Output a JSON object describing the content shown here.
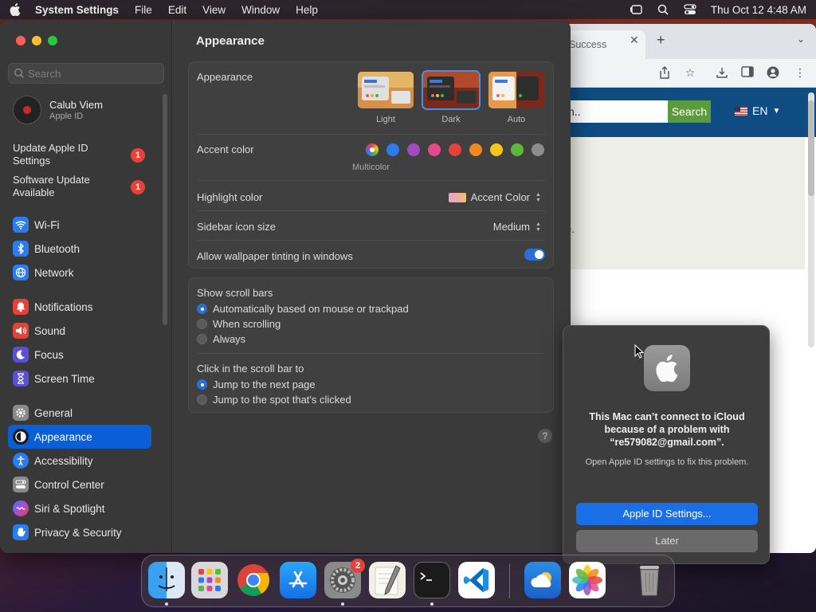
{
  "menubar": {
    "app_name": "System Settings",
    "menus": [
      "File",
      "Edit",
      "View",
      "Window",
      "Help"
    ],
    "datetime": "Thu Oct 12  4:48 AM"
  },
  "browser": {
    "tab_title": "Success",
    "search_text": "ch..",
    "search_button": "Search",
    "language": "EN",
    "fragment": "e."
  },
  "sidebar": {
    "search_placeholder": "Search",
    "account_name": "Calub Viem",
    "account_sub": "Apple ID",
    "notices": [
      {
        "label": "Update Apple ID Settings",
        "badge": "1"
      },
      {
        "label": "Software Update Available",
        "badge": "1"
      }
    ],
    "items": [
      {
        "label": "Wi-Fi",
        "icon": "wifi-icon",
        "color": "#2a7cf0"
      },
      {
        "label": "Bluetooth",
        "icon": "bluetooth-icon",
        "color": "#2a7cf0"
      },
      {
        "label": "Network",
        "icon": "globe-icon",
        "color": "#2a7cf0"
      },
      {
        "label": "Notifications",
        "icon": "bell-icon",
        "color": "#e8413a"
      },
      {
        "label": "Sound",
        "icon": "speaker-icon",
        "color": "#e8413a"
      },
      {
        "label": "Focus",
        "icon": "moon-icon",
        "color": "#5b4fd6"
      },
      {
        "label": "Screen Time",
        "icon": "hourglass-icon",
        "color": "#5b4fd6"
      },
      {
        "label": "General",
        "icon": "gear-icon",
        "color": "#8a8a8a"
      },
      {
        "label": "Appearance",
        "icon": "appearance-icon",
        "color": "#1c1c1c"
      },
      {
        "label": "Accessibility",
        "icon": "accessibility-icon",
        "color": "#2a7cf0"
      },
      {
        "label": "Control Center",
        "icon": "control-center-icon",
        "color": "#8a8a8a"
      },
      {
        "label": "Siri & Spotlight",
        "icon": "siri-icon",
        "color": "#b04ad6"
      },
      {
        "label": "Privacy & Security",
        "icon": "hand-icon",
        "color": "#2a7cf0"
      }
    ],
    "selected": "Appearance"
  },
  "main": {
    "title": "Appearance",
    "appearance_label": "Appearance",
    "appearance_options": [
      "Light",
      "Dark",
      "Auto"
    ],
    "appearance_selected": "Dark",
    "accent_label": "Accent color",
    "accent_colors": [
      "#2a7cf0",
      "#a24ac2",
      "#e8488a",
      "#e8413a",
      "#f08a20",
      "#f5c518",
      "#5cb83a",
      "#8c8c8c"
    ],
    "accent_multicolor_label": "Multicolor",
    "highlight_label": "Highlight color",
    "highlight_value": "Accent Color",
    "icon_size_label": "Sidebar icon size",
    "icon_size_value": "Medium",
    "tinting_label": "Allow wallpaper tinting in windows",
    "tinting_on": true,
    "scrollbars_label": "Show scroll bars",
    "scrollbar_options": [
      "Automatically based on mouse or trackpad",
      "When scrolling",
      "Always"
    ],
    "click_label": "Click in the scroll bar to",
    "click_options": [
      "Jump to the next page",
      "Jump to the spot that's clicked"
    ],
    "help": "?"
  },
  "alert": {
    "title": "This Mac can’t connect to iCloud because of a problem with “re579082@gmail.com”.",
    "body": "Open Apple ID settings to fix this problem.",
    "primary_button": "Apple ID Settings...",
    "secondary_button": "Later"
  },
  "dock": {
    "items": [
      "Finder",
      "Launchpad",
      "Chrome",
      "App Store",
      "System Settings",
      "TextEdit",
      "Terminal",
      "Visual Studio Code",
      "Weather",
      "Photos",
      "Trash"
    ],
    "settings_badge": "2"
  }
}
